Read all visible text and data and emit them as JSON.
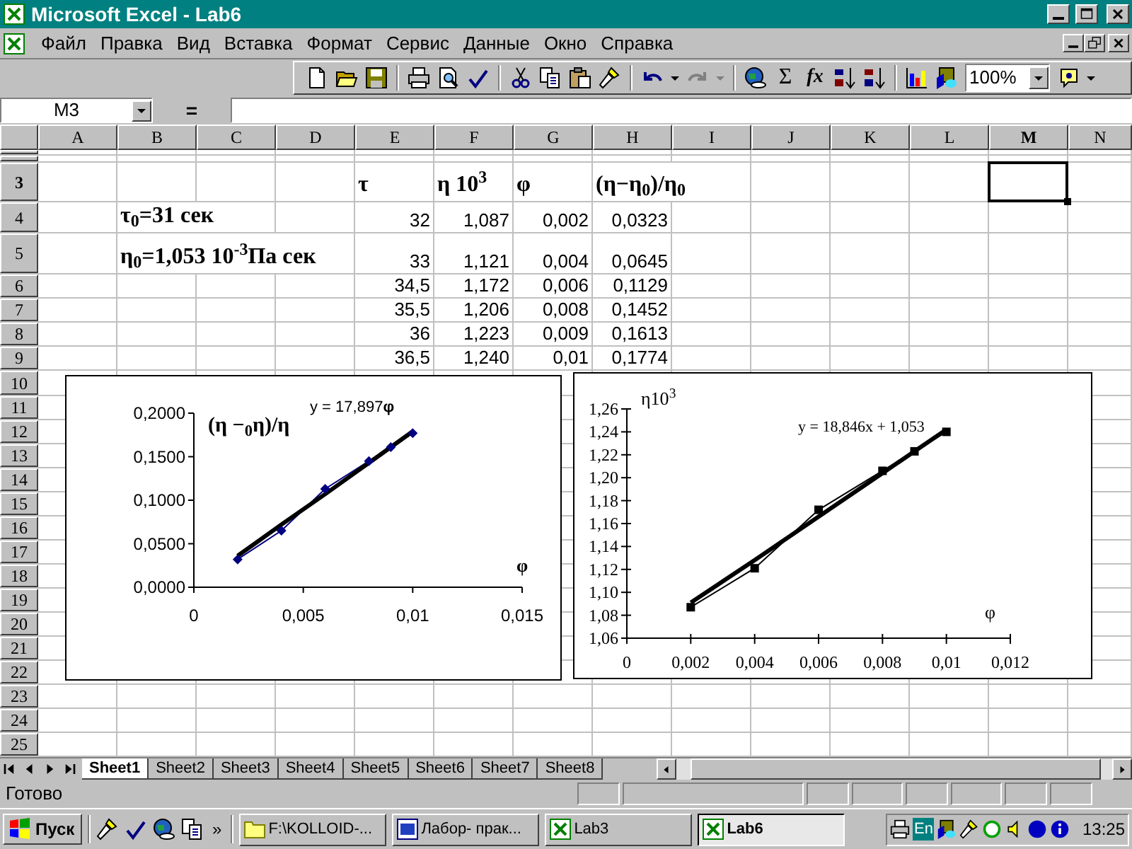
{
  "window": {
    "title": "Microsoft Excel - Lab6"
  },
  "menu": [
    "Файл",
    "Правка",
    "Вид",
    "Вставка",
    "Формат",
    "Сервис",
    "Данные",
    "Окно",
    "Справка"
  ],
  "toolbar": {
    "autosum": "Σ",
    "function": "fx",
    "zoom": "100%"
  },
  "formula_bar": {
    "name_box": "M3",
    "equals": "="
  },
  "columns": [
    {
      "label": "A",
      "selected": false
    },
    {
      "label": "B",
      "selected": false
    },
    {
      "label": "C",
      "selected": false
    },
    {
      "label": "D",
      "selected": false
    },
    {
      "label": "E",
      "selected": false
    },
    {
      "label": "F",
      "selected": false
    },
    {
      "label": "G",
      "selected": false
    },
    {
      "label": "H",
      "selected": false
    },
    {
      "label": "I",
      "selected": false
    },
    {
      "label": "J",
      "selected": false
    },
    {
      "label": "K",
      "selected": false
    },
    {
      "label": "L",
      "selected": false
    },
    {
      "label": "M",
      "selected": true
    },
    {
      "label": "N",
      "selected": false
    }
  ],
  "rows": [
    {
      "label": "3",
      "selected": true,
      "cells": [
        null,
        null,
        null,
        null,
        {
          "kind": "label",
          "text": "τ"
        },
        {
          "kind": "label",
          "text": "η 10$^{3}$"
        },
        {
          "kind": "label",
          "text": "φ"
        },
        {
          "kind": "label",
          "text": "(η−η$_{0}$)/η$_{0}$"
        }
      ]
    },
    {
      "label": "4",
      "selected": false,
      "cells": [
        null,
        {
          "kind": "label",
          "text": "τ$_{0}$=31 сек"
        },
        null,
        null,
        {
          "kind": "number",
          "text": "32"
        },
        {
          "kind": "number",
          "text": "1,087"
        },
        {
          "kind": "number",
          "text": "0,002"
        },
        {
          "kind": "number",
          "text": "0,0323"
        }
      ]
    },
    {
      "label": "5",
      "selected": false,
      "cells": [
        null,
        {
          "kind": "label",
          "text": "η$_{0}$=1,053 10$^{-3}$Па сек"
        },
        null,
        null,
        {
          "kind": "number",
          "text": "33"
        },
        {
          "kind": "number",
          "text": "1,121"
        },
        {
          "kind": "number",
          "text": "0,004"
        },
        {
          "kind": "number",
          "text": "0,0645"
        }
      ]
    },
    {
      "label": "6",
      "selected": false,
      "cells": [
        null,
        null,
        null,
        null,
        {
          "kind": "number",
          "text": "34,5"
        },
        {
          "kind": "number",
          "text": "1,172"
        },
        {
          "kind": "number",
          "text": "0,006"
        },
        {
          "kind": "number",
          "text": "0,1129"
        }
      ]
    },
    {
      "label": "7",
      "selected": false,
      "cells": [
        null,
        null,
        null,
        null,
        {
          "kind": "number",
          "text": "35,5"
        },
        {
          "kind": "number",
          "text": "1,206"
        },
        {
          "kind": "number",
          "text": "0,008"
        },
        {
          "kind": "number",
          "text": "0,1452"
        }
      ]
    },
    {
      "label": "8",
      "selected": false,
      "cells": [
        null,
        null,
        null,
        null,
        {
          "kind": "number",
          "text": "36"
        },
        {
          "kind": "number",
          "text": "1,223"
        },
        {
          "kind": "number",
          "text": "0,009"
        },
        {
          "kind": "number",
          "text": "0,1613"
        }
      ]
    },
    {
      "label": "9",
      "selected": false,
      "cells": [
        null,
        null,
        null,
        null,
        {
          "kind": "number",
          "text": "36,5"
        },
        {
          "kind": "number",
          "text": "1,240"
        },
        {
          "kind": "number",
          "text": "0,01"
        },
        {
          "kind": "number",
          "text": "0,1774"
        }
      ]
    },
    {
      "label": "10",
      "selected": false
    },
    {
      "label": "11",
      "selected": false
    },
    {
      "label": "12",
      "selected": false
    },
    {
      "label": "13",
      "selected": false
    },
    {
      "label": "14",
      "selected": false
    },
    {
      "label": "15",
      "selected": false
    },
    {
      "label": "16",
      "selected": false
    },
    {
      "label": "17",
      "selected": false
    },
    {
      "label": "18",
      "selected": false
    },
    {
      "label": "19",
      "selected": false
    },
    {
      "label": "20",
      "selected": false
    },
    {
      "label": "21",
      "selected": false
    },
    {
      "label": "22",
      "selected": false
    },
    {
      "label": "23",
      "selected": false
    },
    {
      "label": "24",
      "selected": false
    },
    {
      "label": "25",
      "selected": false
    }
  ],
  "charts": [
    {
      "chart_data": {
        "type": "scatter",
        "xlabel": "φ",
        "ylabel": "(η −$_{0}$η)/η",
        "x": [
          0.002,
          0.004,
          0.006,
          0.008,
          0.009,
          0.01
        ],
        "series": [
          {
            "type": "line",
            "marker": "diamond",
            "color": "#000080",
            "values": [
              0.032,
              0.065,
              0.113,
              0.145,
              0.161,
              0.177
            ]
          },
          {
            "type": "line",
            "color": "#000000",
            "values": [
              0.036,
              0.072,
              0.107,
              0.143,
              0.161,
              0.179
            ]
          }
        ],
        "xlim": [
          0,
          0.015
        ],
        "ylim": [
          0,
          0.2
        ],
        "xticks": [
          {
            "value": 0,
            "label": "0"
          },
          {
            "value": 0.005,
            "label": "0,005"
          },
          {
            "value": 0.01,
            "label": "0,01"
          },
          {
            "value": 0.015,
            "label": "0,015"
          }
        ],
        "yticks": [
          {
            "value": 0,
            "label": "0,0000"
          },
          {
            "value": 0.05,
            "label": "0,0500"
          },
          {
            "value": 0.1,
            "label": "0,1000"
          },
          {
            "value": 0.15,
            "label": "0,1500"
          },
          {
            "value": 0.2,
            "label": "0,2000"
          }
        ],
        "annotations": [
          {
            "text": "y = 17,897**φ**"
          }
        ]
      }
    },
    {
      "chart_data": {
        "type": "scatter",
        "xlabel": "φ",
        "ylabel": "η10$^{3}$",
        "x": [
          0.002,
          0.004,
          0.006,
          0.008,
          0.009,
          0.01
        ],
        "series": [
          {
            "type": "line",
            "marker": "square",
            "color": "#000000",
            "values": [
              1.087,
              1.121,
              1.172,
              1.206,
              1.223,
              1.24
            ]
          },
          {
            "type": "line",
            "color": "#000000",
            "values": [
              1.091,
              1.128,
              1.166,
              1.204,
              1.223,
              1.242
            ]
          }
        ],
        "xlim": [
          0,
          0.012
        ],
        "ylim": [
          1.06,
          1.26
        ],
        "xticks": [
          {
            "value": 0,
            "label": "0"
          },
          {
            "value": 0.002,
            "label": "0,002"
          },
          {
            "value": 0.004,
            "label": "0,004"
          },
          {
            "value": 0.006,
            "label": "0,006"
          },
          {
            "value": 0.008,
            "label": "0,008"
          },
          {
            "value": 0.01,
            "label": "0,01"
          },
          {
            "value": 0.012,
            "label": "0,012"
          }
        ],
        "yticks": [
          {
            "value": 1.06,
            "label": "1,06"
          },
          {
            "value": 1.08,
            "label": "1,08"
          },
          {
            "value": 1.1,
            "label": "1,10"
          },
          {
            "value": 1.12,
            "label": "1,12"
          },
          {
            "value": 1.14,
            "label": "1,14"
          },
          {
            "value": 1.16,
            "label": "1,16"
          },
          {
            "value": 1.18,
            "label": "1,18"
          },
          {
            "value": 1.2,
            "label": "1,20"
          },
          {
            "value": 1.22,
            "label": "1,22"
          },
          {
            "value": 1.24,
            "label": "1,24"
          },
          {
            "value": 1.26,
            "label": "1,26"
          }
        ],
        "annotations": [
          {
            "text": "y = 18,846x + 1,053"
          }
        ]
      }
    }
  ],
  "sheet_tabs": [
    {
      "label": "Sheet1",
      "selected": true
    },
    {
      "label": "Sheet2",
      "selected": false
    },
    {
      "label": "Sheet3",
      "selected": false
    },
    {
      "label": "Sheet4",
      "selected": false
    },
    {
      "label": "Sheet5",
      "selected": false
    },
    {
      "label": "Sheet6",
      "selected": false
    },
    {
      "label": "Sheet7",
      "selected": false
    },
    {
      "label": "Sheet8",
      "selected": false
    }
  ],
  "status_bar": {
    "text": "Готово"
  },
  "taskbar": {
    "start": "Пуск",
    "more": "»",
    "tasks": [
      {
        "kind": "folder",
        "label": "F:\\KOLLOID-...",
        "selected": false
      },
      {
        "kind": "word",
        "label": "Лабор- прак...",
        "selected": false
      },
      {
        "kind": "excel",
        "label": "Lab3",
        "selected": false
      },
      {
        "kind": "excel",
        "label": "Lab6",
        "selected": true
      }
    ],
    "language": "En",
    "clock": "13:25"
  }
}
